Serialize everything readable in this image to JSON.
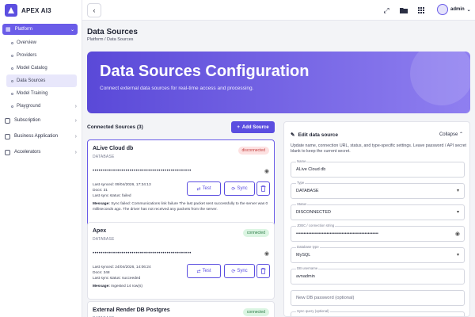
{
  "app": {
    "name": "APEX AI3"
  },
  "sidebar": {
    "platform": {
      "label": "Platform"
    },
    "sub_items": [
      {
        "label": "Overview"
      },
      {
        "label": "Providers"
      },
      {
        "label": "Model Catalog"
      },
      {
        "label": "Data Sources"
      },
      {
        "label": "Model Training"
      },
      {
        "label": "Playground"
      }
    ],
    "items": [
      {
        "label": "Subscription"
      },
      {
        "label": "Business Application"
      },
      {
        "label": "Accelerators"
      }
    ]
  },
  "topbar": {
    "user": "admin"
  },
  "page": {
    "title": "Data Sources",
    "breadcrumb": "Platform / Data Sources"
  },
  "hero": {
    "title": "Data Sources Configuration",
    "subtitle": "Connect external data sources for real-time access and processing."
  },
  "connected": {
    "title": "Connected Sources (3)",
    "add_label": "Add Source"
  },
  "cards": [
    {
      "name": "ALive Cloud db",
      "type": "DATABASE",
      "status": "disconnected",
      "secret": "••••••••••••••••••••••••••••••••••••••••••••••••",
      "last_synced": "Last synced: 09/04/2026, 17:34:13",
      "docs": "Docs: 31",
      "sync_status": "Last sync status: failed",
      "message_label": "Message:",
      "message": "Sync failed: Communications link failure The last packet sent successfully to the server was 0 milliseconds ago. The driver has not received any packets from the server.",
      "test_label": "Test",
      "sync_label": "Sync"
    },
    {
      "name": "Apex",
      "type": "DATABASE",
      "status": "connected",
      "secret": "••••••••••••••••••••••••••••••••••••••••••••••••",
      "last_synced": "Last synced: 24/04/2026, 14:06:24",
      "docs": "Docs: 348",
      "sync_status": "Last sync status: succeeded",
      "message_label": "Message:",
      "message": "Ingested 14 row(s)",
      "test_label": "Test",
      "sync_label": "Sync"
    },
    {
      "name": "External Render DB Postgres",
      "type": "DATABASE",
      "status": "connected"
    }
  ],
  "edit": {
    "title": "Edit data source",
    "collapse": "Collapse",
    "description": "Update name, connection URL, status, and type-specific settings. Leave password / API secret blank to keep the current secret.",
    "fields": {
      "name": {
        "label": "Name",
        "value": "ALive Cloud db"
      },
      "type": {
        "label": "Type",
        "value": "DATABASE"
      },
      "status": {
        "label": "Status",
        "value": "DISCONNECTED"
      },
      "jdbc": {
        "label": "JDBC / connection string",
        "value": "••••••••••••••••••••••••••••••••••••••••••••••••••••••"
      },
      "db_type": {
        "label": "Database type",
        "value": "MySQL"
      },
      "db_user": {
        "label": "DB username",
        "value": "avnadmin"
      },
      "db_password": {
        "placeholder": "New DB password (optional)"
      },
      "sync_query": {
        "label": "Sync query (optional)"
      }
    }
  },
  "colors": {
    "accent": "#5b4ee0",
    "danger": "#c24040",
    "success": "#2a7a45"
  }
}
